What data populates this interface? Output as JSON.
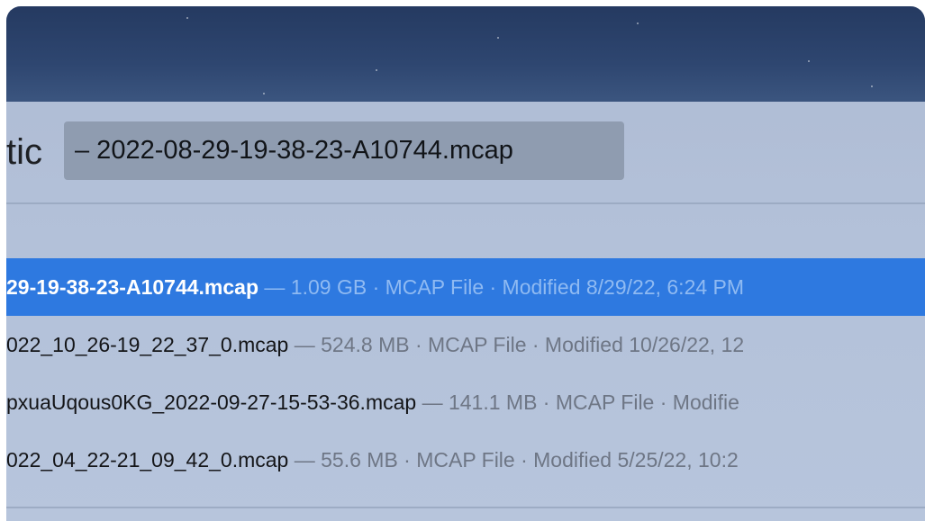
{
  "window": {
    "app_title_fragment": "tic",
    "document_title": "– 2022-08-29-19-38-23-A10744.mcap"
  },
  "recent_files": [
    {
      "name": "29-19-38-23-A10744.mcap",
      "meta": " — 1.09 GB · MCAP File · Modified 8/29/22, 6:24 PM",
      "selected": true
    },
    {
      "name": "022_10_26-19_22_37_0.mcap",
      "meta": " — 524.8 MB · MCAP File · Modified 10/26/22, 12",
      "selected": false
    },
    {
      "name": "pxuaUqous0KG_2022-09-27-15-53-36.mcap",
      "meta": " — 141.1 MB · MCAP File · Modifie",
      "selected": false
    },
    {
      "name": "022_04_22-21_09_42_0.mcap",
      "meta": " — 55.6 MB · MCAP File · Modified 5/25/22, 10:2",
      "selected": false
    }
  ],
  "colors": {
    "selection": "#2e79e0",
    "sky": "#2e4670",
    "panel": "#b3c1d9"
  }
}
